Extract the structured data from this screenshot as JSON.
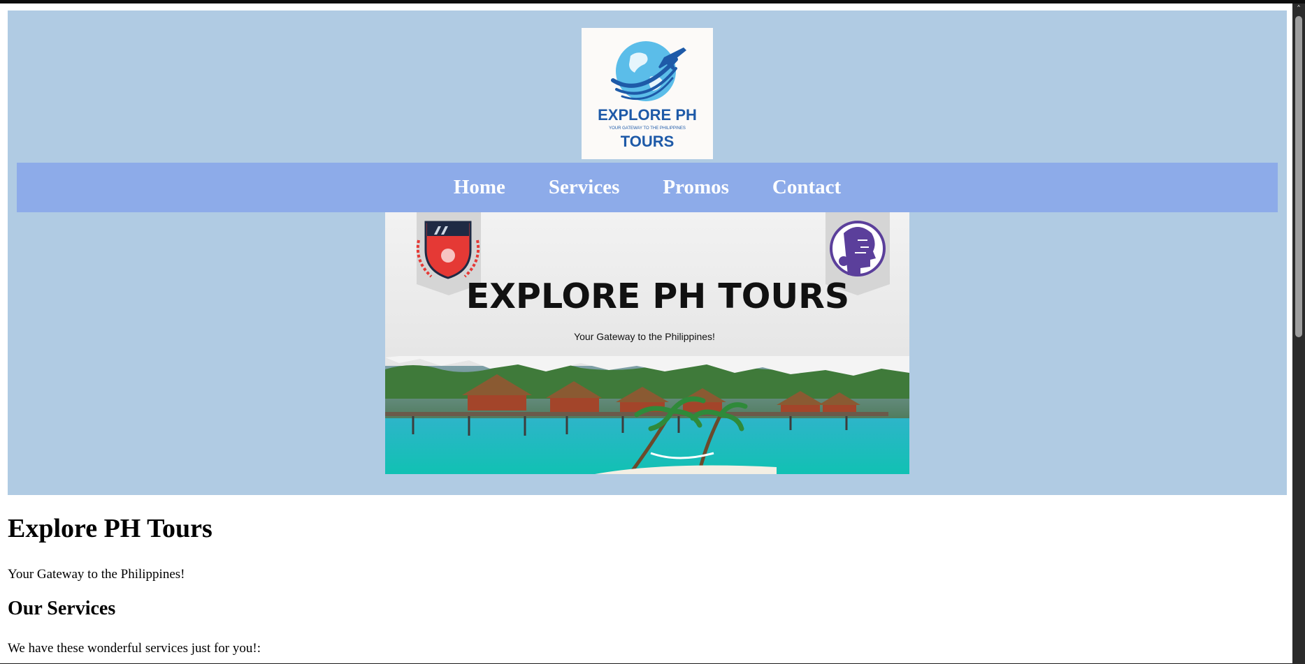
{
  "header": {
    "logo": {
      "line1": "EXPLORE PH",
      "tagline": "YOUR GATEWAY TO THE PHILIPPINES",
      "line2": "TOURS"
    }
  },
  "nav": {
    "items": [
      {
        "label": "Home"
      },
      {
        "label": "Services"
      },
      {
        "label": "Promos"
      },
      {
        "label": "Contact"
      }
    ]
  },
  "banner": {
    "title": "EXPLORE PH TOURS",
    "subtitle": "Your Gateway to the Philippines!"
  },
  "main": {
    "title": "Explore PH Tours",
    "tagline": "Your Gateway to the Philippines!",
    "services_heading": "Our Services",
    "services_text": "We have these wonderful services just for you!:"
  },
  "colors": {
    "header_bg": "#b0cbe3",
    "nav_bg": "#8dabe9",
    "brand_blue": "#1e5aa8"
  }
}
